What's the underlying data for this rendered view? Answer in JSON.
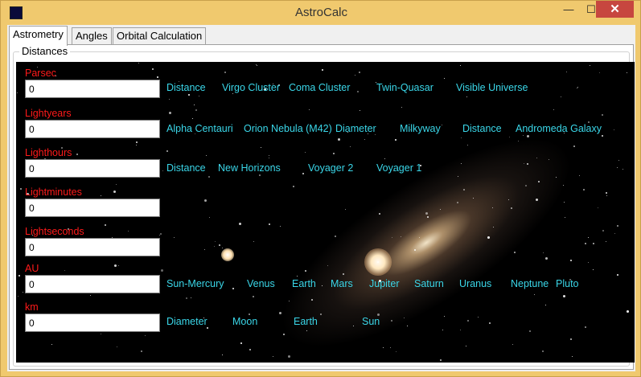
{
  "window": {
    "title": "AstroCalc",
    "minimize_label": "—",
    "maximize_label": "☐",
    "close_label": "✕"
  },
  "tabs": [
    {
      "label": "Astrometry",
      "active": true
    },
    {
      "label": "Angles",
      "active": false
    },
    {
      "label": "Orbital Calculation",
      "active": false
    }
  ],
  "group": {
    "title": "Distances"
  },
  "rows": [
    {
      "label": "Parsec",
      "value": "0",
      "links": [
        "Distance",
        "Virgo Cluster",
        "Coma Cluster",
        "Twin-Quasar",
        "Visible Universe"
      ]
    },
    {
      "label": "Lightyears",
      "value": "0",
      "links": [
        "Alpha Centauri",
        "Orion Nebula (M42)",
        "Diameter",
        "Milkyway",
        "Distance",
        "Andromeda Galaxy"
      ]
    },
    {
      "label": "Lighthours",
      "value": "0",
      "links": [
        "Distance",
        "New Horizons",
        "Voyager 2",
        "Voyager 1"
      ]
    },
    {
      "label": "Lightminutes",
      "value": "0",
      "links": []
    },
    {
      "label": "Lightseconds",
      "value": "0",
      "links": []
    },
    {
      "label": "AU",
      "value": "0",
      "links": [
        "Sun-Mercury",
        "Venus",
        "Earth",
        "Mars",
        "Jupiter",
        "Saturn",
        "Uranus",
        "Neptune",
        "Pluto"
      ]
    },
    {
      "label": "km",
      "value": "0",
      "links": [
        "Diameter",
        "Moon",
        "Earth",
        "Sun"
      ]
    }
  ],
  "colors": {
    "label_red": "#ff1a1a",
    "link_cyan": "#3ad6e8",
    "titlebar": "#f0c96e",
    "close_button": "#c7463f"
  },
  "icons": {
    "app": "app-icon",
    "minimize": "minimize-icon",
    "maximize": "maximize-icon",
    "close": "close-icon"
  }
}
